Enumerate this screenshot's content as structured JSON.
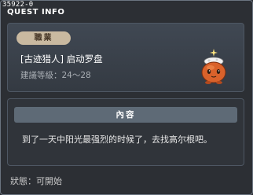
{
  "window": {
    "quest_id": "35922-0",
    "title": "QUEST INFO"
  },
  "quest": {
    "job_label": "職業",
    "name": "[古迹猎人] 启动罗盘",
    "recommended_level": "建議等級：24～28"
  },
  "content": {
    "header": "內容",
    "text": "到了一天中阳光最强烈的时候了，去找高尔根吧。"
  },
  "status": {
    "text": "狀態：可開始"
  },
  "colors": {
    "badge": "#c9b9a0",
    "section_bar": "#5e6a76",
    "npc_body": "#d9622b"
  },
  "icons": {
    "npc": "orange-mushroom-npc-icon"
  }
}
